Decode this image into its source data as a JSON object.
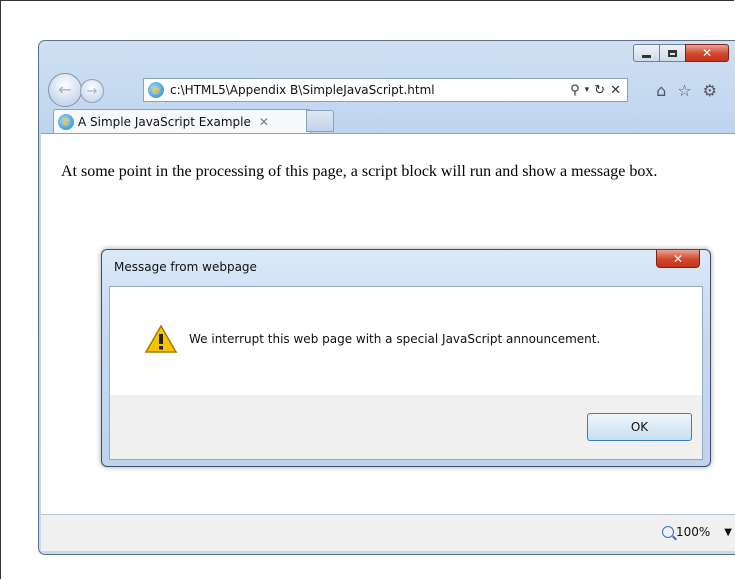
{
  "browser": {
    "url": "c:\\HTML5\\Appendix B\\SimpleJavaScript.html",
    "tab_title": "A Simple JavaScript Example",
    "zoom": "100%"
  },
  "page": {
    "text": "At some point in the processing of this page, a script block will run and show a message box."
  },
  "dialog": {
    "title": "Message from webpage",
    "message": "We interrupt this web page with a special JavaScript announcement.",
    "ok_label": "OK"
  },
  "icons": {
    "back": "back-arrow-icon",
    "forward": "forward-arrow-icon",
    "home": "home-icon",
    "favorites": "star-icon",
    "tools": "gear-icon",
    "warning": "warning-icon"
  }
}
